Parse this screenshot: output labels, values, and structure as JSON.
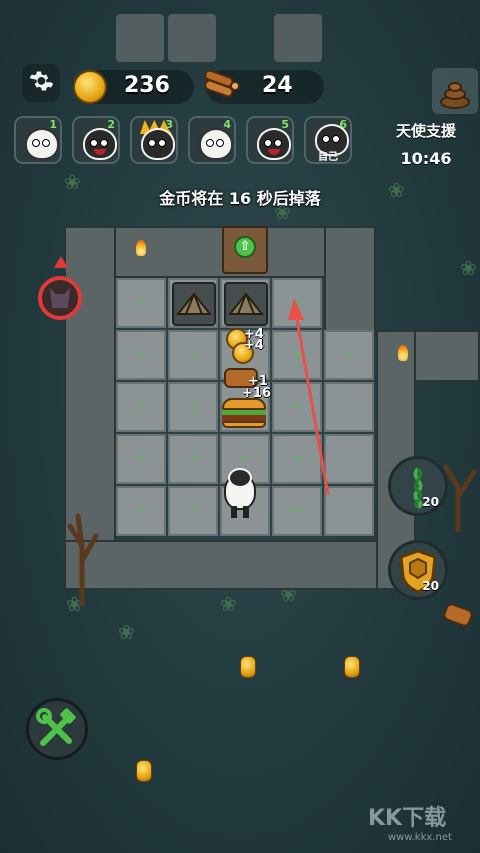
{
  "hud": {
    "coins": "236",
    "wood": "24",
    "coin_icon": "coin-icon",
    "wood_icon": "logs-icon",
    "settings_icon": "gear-icon"
  },
  "team": [
    {
      "num": "1",
      "sub": "",
      "style": "white"
    },
    {
      "num": "2",
      "sub": "",
      "style": "dark"
    },
    {
      "num": "3",
      "sub": "",
      "style": "spiky"
    },
    {
      "num": "4",
      "sub": "",
      "style": "white"
    },
    {
      "num": "5",
      "sub": "",
      "style": "dark"
    },
    {
      "num": "6",
      "sub": "自己",
      "style": "dark-plain"
    }
  ],
  "angel_support": {
    "label": "天使支援",
    "timer": "10:46"
  },
  "notice": "金币将在 16 秒后掉落",
  "floats": [
    "+4",
    "+4",
    "+1",
    "+16"
  ],
  "side_buttons": [
    {
      "name": "thorn-vine-button",
      "icon": "vine-icon",
      "count": "20"
    },
    {
      "name": "shield-button",
      "icon": "shield-icon",
      "count": "20"
    }
  ],
  "build_icon": "hammer-wrench-icon",
  "watermark": "KK下载 www.kkx.net",
  "colors": {
    "accent_green": "#4ec24a",
    "coin": "#e6a614",
    "arrow": "#e8504a"
  }
}
